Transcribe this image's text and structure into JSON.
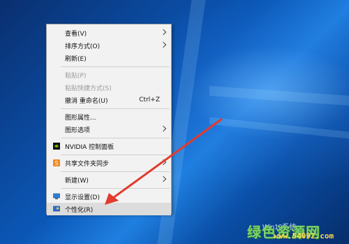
{
  "context_menu": {
    "items": [
      {
        "label": "查看(V)",
        "submenu": true
      },
      {
        "label": "排序方式(O)",
        "submenu": true
      },
      {
        "label": "刷新(E)"
      },
      {
        "label": "粘贴(P)",
        "disabled": true
      },
      {
        "label": "粘贴快捷方式(S)",
        "disabled": true
      },
      {
        "label": "撤消 重命名(U)",
        "shortcut": "Ctrl+Z"
      },
      {
        "label": "图形属性..."
      },
      {
        "label": "图形选项",
        "submenu": true
      },
      {
        "label": "NVIDIA 控制面板",
        "icon": "nvidia-icon"
      },
      {
        "label": "共享文件夹同步",
        "icon": "sync-icon",
        "submenu": true
      },
      {
        "label": "新建(W)",
        "submenu": true
      },
      {
        "label": "显示设置(D)",
        "icon": "display-icon"
      },
      {
        "label": "个性化(R)",
        "icon": "personalize-icon",
        "highlighted": true
      }
    ]
  },
  "watermark": {
    "logo_text": "绿色资源网",
    "site_text": "Win10系统",
    "url": "www.54092.com"
  },
  "colors": {
    "menu_bg": "#f2f2f2",
    "annotation_arrow": "#e23b2e",
    "nvidia_green": "#76b900"
  }
}
